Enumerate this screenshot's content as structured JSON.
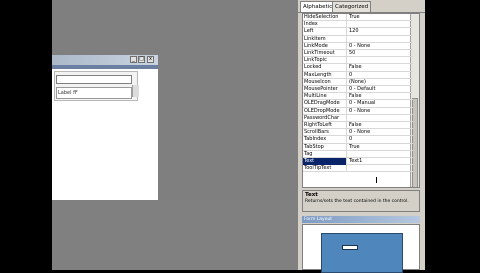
{
  "tabs": [
    {
      "label": "Alphabetic"
    },
    {
      "label": "Categorized"
    }
  ],
  "form": {
    "title": "",
    "textbox_value": "",
    "combo_value": "Label fF",
    "min_label": "_",
    "max_label": "□",
    "close_label": "x"
  },
  "properties": [
    {
      "name": "HideSelection",
      "value": "True"
    },
    {
      "name": "Index",
      "value": ""
    },
    {
      "name": "Left",
      "value": "120"
    },
    {
      "name": "LinkItem",
      "value": ""
    },
    {
      "name": "LinkMode",
      "value": "0 - None"
    },
    {
      "name": "LinkTimeout",
      "value": "50"
    },
    {
      "name": "LinkTopic",
      "value": ""
    },
    {
      "name": "Locked",
      "value": "False"
    },
    {
      "name": "MaxLength",
      "value": "0"
    },
    {
      "name": "MouseIcon",
      "value": "(None)"
    },
    {
      "name": "MousePointer",
      "value": "0 - Default"
    },
    {
      "name": "MultiLine",
      "value": "False"
    },
    {
      "name": "OLEDragMode",
      "value": "0 - Manual"
    },
    {
      "name": "OLEDropMode",
      "value": "0 - None"
    },
    {
      "name": "PasswordChar",
      "value": ""
    },
    {
      "name": "RightToLeft",
      "value": "False"
    },
    {
      "name": "ScrollBars",
      "value": "0 - None"
    },
    {
      "name": "TabIndex",
      "value": "0"
    },
    {
      "name": "TabStop",
      "value": "True"
    },
    {
      "name": "Tag",
      "value": ""
    },
    {
      "name": "Text",
      "value": "Text1"
    },
    {
      "name": "ToolTipText",
      "value": ""
    }
  ],
  "selected_property": "Text",
  "description": {
    "title": "Text",
    "text": "Returns/sets the text contained in the control."
  },
  "layout": {
    "header": "Form Layout"
  },
  "colors": {
    "selection": "#0a246a",
    "workspace": "#7f7f7f",
    "panel": "#d4d0c8",
    "preview": "#4f87bd"
  }
}
